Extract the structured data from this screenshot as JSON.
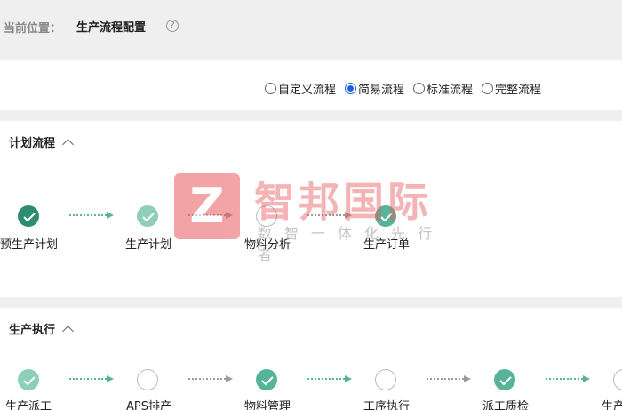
{
  "breadcrumb": {
    "label": "当前位置：",
    "current": "生产流程配置",
    "help": "?"
  },
  "flow_options": [
    {
      "label": "自定义流程",
      "checked": false
    },
    {
      "label": "简易流程",
      "checked": true
    },
    {
      "label": "标准流程",
      "checked": false
    },
    {
      "label": "完整流程",
      "checked": false
    }
  ],
  "plan_section": {
    "title": "计划流程",
    "steps": [
      {
        "label": "预生产计划",
        "status": "done"
      },
      {
        "label": "生产计划",
        "status": "done"
      },
      {
        "label": "物料分析",
        "status": "todo"
      },
      {
        "label": "生产订单",
        "status": "done"
      }
    ]
  },
  "exec_section": {
    "title": "生产执行",
    "steps": [
      {
        "label": "生产派工",
        "status": "done"
      },
      {
        "label": "APS排产",
        "status": "todo"
      },
      {
        "label": "物料管理",
        "status": "done"
      },
      {
        "label": "工序执行",
        "status": "todo"
      },
      {
        "label": "派工质检",
        "status": "done"
      },
      {
        "label": "生产",
        "status": "todo"
      }
    ]
  },
  "watermark": {
    "logo_letter": "Z",
    "title": "智邦国际",
    "subtitle": "数智一体化先行者"
  },
  "colors": {
    "accent": "#58b498",
    "radio": "#1a66d6",
    "watermark": "#e8595c"
  }
}
